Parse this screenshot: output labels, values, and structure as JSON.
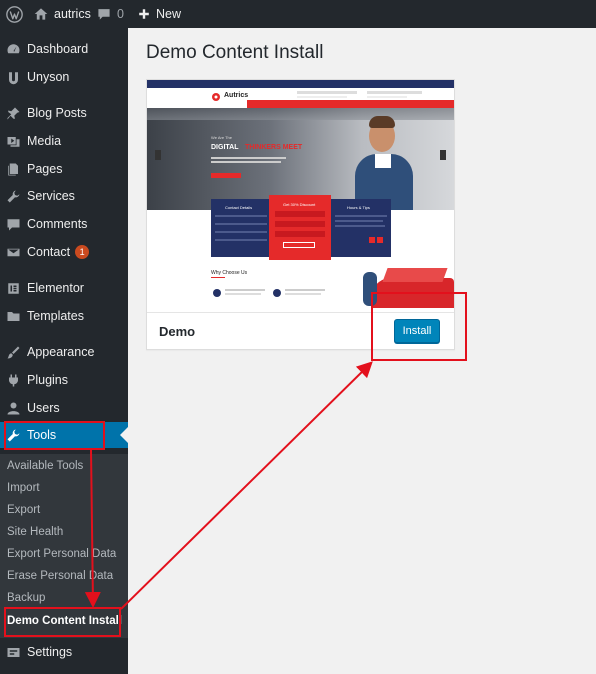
{
  "adminbar": {
    "site_name": "autrics",
    "comments_count": "0",
    "new_label": "New",
    "icons": [
      "wordpress-logo-icon",
      "home-icon",
      "comment-icon",
      "plus-icon"
    ]
  },
  "sidebar": {
    "items": [
      {
        "label": "Dashboard",
        "icon": "dashboard-icon"
      },
      {
        "label": "Unyson",
        "icon": "unyson-icon"
      },
      {
        "label": "Blog Posts",
        "icon": "pin-icon"
      },
      {
        "label": "Media",
        "icon": "media-icon"
      },
      {
        "label": "Pages",
        "icon": "pages-icon"
      },
      {
        "label": "Services",
        "icon": "wrench-icon"
      },
      {
        "label": "Comments",
        "icon": "comment-icon"
      },
      {
        "label": "Contact",
        "icon": "mail-icon",
        "badge": "1"
      },
      {
        "label": "Elementor",
        "icon": "elementor-icon"
      },
      {
        "label": "Templates",
        "icon": "folder-icon"
      },
      {
        "label": "Appearance",
        "icon": "brush-icon"
      },
      {
        "label": "Plugins",
        "icon": "plug-icon"
      },
      {
        "label": "Users",
        "icon": "user-icon"
      },
      {
        "label": "Tools",
        "icon": "wrench-icon"
      },
      {
        "label": "Settings",
        "icon": "settings-icon"
      }
    ],
    "submenu": [
      "Available Tools",
      "Import",
      "Export",
      "Site Health",
      "Export Personal Data",
      "Erase Personal Data",
      "Backup",
      "Demo Content Install"
    ]
  },
  "main": {
    "title": "Demo Content Install",
    "theme": {
      "name": "Demo",
      "install_label": "Install",
      "preview": {
        "logo_text": "Autrics",
        "hero_kicker": "We Are The",
        "hero_title_white": "DIGITAL",
        "hero_title_red": "THINKERS MEET",
        "box_left_title": "Contact Details",
        "box_mid_title": "Get 30% Discount",
        "box_right_title": "Hours & Tips",
        "section_title": "Why Choose Us"
      }
    }
  },
  "colors": {
    "adminbar_bg": "#23282d",
    "sidebar_bg": "#23282d",
    "submenu_bg": "#32373c",
    "active": "#0073aa",
    "button": "#0085ba",
    "highlight": "#e3101c",
    "brand_red": "#e52a2a",
    "brand_navy": "#233166"
  }
}
